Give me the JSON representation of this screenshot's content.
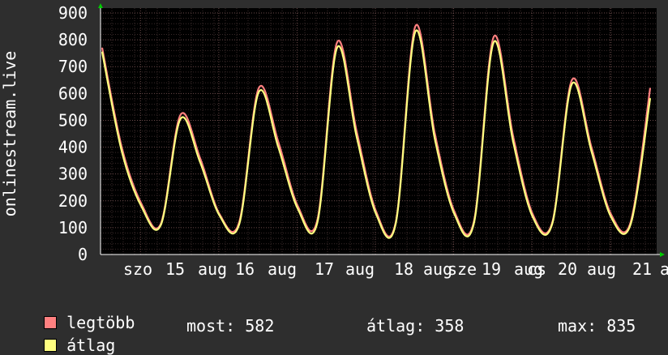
{
  "chart_data": {
    "type": "line",
    "ylabel": "onlinestream.live",
    "ylim": [
      0,
      900
    ],
    "yticks": [
      0,
      100,
      200,
      300,
      400,
      500,
      600,
      700,
      800,
      900
    ],
    "xtick_labels": [
      "szo",
      "15",
      "aug",
      "16",
      "aug",
      "17",
      "aug",
      "18",
      "aug",
      "sze",
      "19",
      "aug",
      "cs",
      "20",
      "aug",
      "21",
      "a"
    ],
    "x": [
      "aug 14 12:00",
      "aug 14 18:00",
      "aug 15 00:00",
      "aug 15 06:00",
      "aug 15 12:00",
      "aug 15 18:00",
      "aug 16 00:00",
      "aug 16 06:00",
      "aug 16 12:00",
      "aug 16 18:00",
      "aug 17 00:00",
      "aug 17 06:00",
      "aug 17 12:00",
      "aug 17 18:00",
      "aug 18 00:00",
      "aug 18 06:00",
      "aug 18 12:00",
      "aug 18 18:00",
      "aug 19 00:00",
      "aug 19 06:00",
      "aug 19 12:00",
      "aug 19 18:00",
      "aug 20 00:00",
      "aug 20 06:00",
      "aug 20 12:00",
      "aug 20 18:00",
      "aug 21 00:00",
      "aug 21 06:00"
    ],
    "series": [
      {
        "name": "legtöbb",
        "color": "#ff8080",
        "values": [
          770,
          400,
          190,
          115,
          520,
          360,
          150,
          120,
          620,
          420,
          180,
          130,
          790,
          460,
          160,
          120,
          850,
          450,
          160,
          125,
          810,
          440,
          150,
          120,
          650,
          400,
          150,
          120,
          620
        ]
      },
      {
        "name": "átlag",
        "color": "#ffff80",
        "values": [
          755,
          385,
          180,
          110,
          505,
          345,
          145,
          112,
          605,
          400,
          170,
          120,
          770,
          440,
          150,
          115,
          830,
          430,
          150,
          118,
          790,
          420,
          140,
          115,
          635,
          385,
          140,
          112,
          582
        ]
      }
    ],
    "grid": true
  },
  "legend": [
    {
      "label": "legtöbb",
      "color": "#ff8080"
    },
    {
      "label": "átlag",
      "color": "#ffff80"
    }
  ],
  "stats": {
    "most": "most: 582",
    "atlag": "átlag: 358",
    "max": "max: 835"
  },
  "colors": {
    "background": "#2e2e2e",
    "plot_bg": "#000000",
    "grid_minor": "#3a2a2a",
    "grid_major": "#6a4a4a",
    "arrow": "#00cc00"
  }
}
